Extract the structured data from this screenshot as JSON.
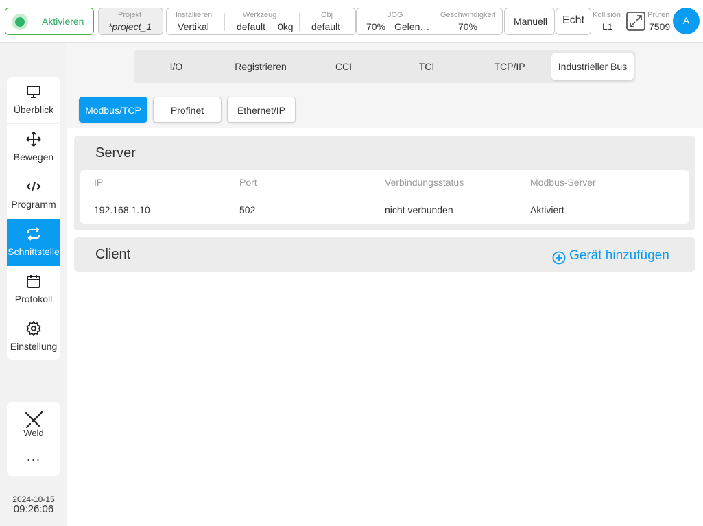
{
  "topbar": {
    "activate_label": "Aktivieren",
    "project": {
      "caption": "Projekt",
      "value": "*project_1"
    },
    "install": {
      "caption": "Installieren",
      "value": "Vertikal"
    },
    "tool": {
      "caption": "Werkzeug",
      "value": "default",
      "weight": "0kg"
    },
    "obj": {
      "caption": "Obj",
      "value": "default"
    },
    "jog": {
      "caption": "JOG",
      "value": "70%",
      "mode": "Gelen…"
    },
    "speed": {
      "caption": "Geschwindigkeit",
      "value": "70%"
    },
    "manual_label": "Manuell",
    "real_label": "Echt",
    "collision": {
      "caption": "Kollision",
      "value": "L1"
    },
    "check": {
      "caption": "Prüfen",
      "value": "7509"
    },
    "avatar_letter": "A"
  },
  "sidebar": {
    "items": [
      {
        "label": "Überblick",
        "icon": "monitor-icon"
      },
      {
        "label": "Bewegen",
        "icon": "move-icon"
      },
      {
        "label": "Programm",
        "icon": "code-icon"
      },
      {
        "label": "Schnittstelle",
        "icon": "repeat-icon",
        "active": true
      },
      {
        "label": "Protokoll",
        "icon": "calendar-icon"
      },
      {
        "label": "Einstellung",
        "icon": "gear-icon"
      }
    ],
    "weld_label": "Weld",
    "more_label": "···",
    "date": "2024-10-15",
    "time": "09:26:06"
  },
  "tabs": [
    "I/O",
    "Registrieren",
    "CCI",
    "TCI",
    "TCP/IP",
    "Industrieller Bus"
  ],
  "active_tab": "Industrieller Bus",
  "subtabs": [
    "Modbus/TCP",
    "Profinet",
    "Ethernet/IP"
  ],
  "active_subtab": "Modbus/TCP",
  "server": {
    "title": "Server",
    "columns": [
      "IP",
      "Port",
      "Verbindungsstatus",
      "Modbus-Server"
    ],
    "row": [
      "192.168.1.10",
      "502",
      "nicht verbunden",
      "Aktiviert"
    ]
  },
  "client": {
    "title": "Client",
    "add_device_label": "Gerät hinzufügen"
  },
  "colors": {
    "accent": "#0a9cf0",
    "active_green": "#2fb56a"
  }
}
